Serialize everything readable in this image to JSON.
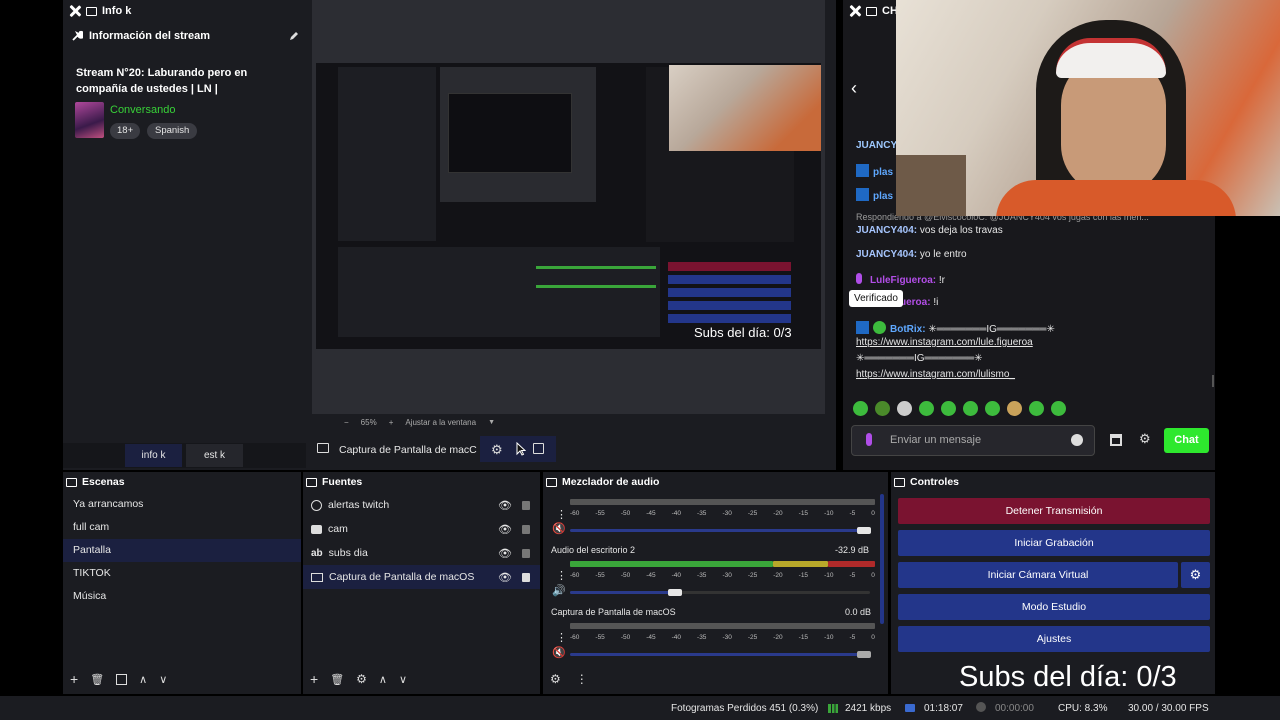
{
  "info_dock": {
    "title": "Info k",
    "header": "Información del stream",
    "stream_title": "Stream N°20: Laburando pero en compañía de ustedes | LN |",
    "category": "Conversando",
    "tags": [
      "18+",
      "Spanish"
    ],
    "tabs": [
      "info k",
      "est k"
    ]
  },
  "preview": {
    "zoom": "65%",
    "fit_label": "Ajustar a la ventana",
    "subs_overlay": "Subs del día: 0/3",
    "source_label": "Captura de Pantalla de macC"
  },
  "chat_dock": {
    "title": "CHA",
    "messages": [
      {
        "user": "JUANCY",
        "text": ""
      },
      {
        "user": "plas",
        "text": ""
      },
      {
        "user": "plas",
        "text": ""
      },
      {
        "reply": "Respondiendo a @ElviscocoloC: @JUANCY404 vos jugas con las men..."
      },
      {
        "user": "JUANCY404:",
        "text": "vos deja los travas"
      },
      {
        "user": "JUANCY404:",
        "text": "yo le entro"
      },
      {
        "user": "LuleFigueroa:",
        "text": "!r"
      },
      {
        "user": "ueroa:",
        "text": "!i"
      },
      {
        "user": "BotRix:",
        "text": "✳═══════IG═══════✳"
      }
    ],
    "links": [
      "https://www.instagram.com/lule.figueroa",
      "✳═══════IG═══════✳",
      "https://www.instagram.com/lulismo_"
    ],
    "tooltip": "Verificado",
    "input_placeholder": "Enviar un mensaje",
    "send_label": "Chat"
  },
  "scenes": {
    "title": "Escenas",
    "items": [
      "Ya arrancamos",
      "full cam",
      "Pantalla",
      "TIKTOK",
      "Música"
    ],
    "active": 2
  },
  "sources": {
    "title": "Fuentes",
    "items": [
      "alertas twitch",
      "cam",
      "subs dia",
      "Captura de Pantalla de macOS"
    ]
  },
  "mixer": {
    "title": "Mezclador de audio",
    "channels": [
      {
        "name": "",
        "db": ""
      },
      {
        "name": "Audio del escritorio 2",
        "db": "-32.9 dB"
      },
      {
        "name": "Captura de Pantalla de macOS",
        "db": "0.0 dB"
      }
    ],
    "ticks": [
      "-60",
      "-55",
      "-50",
      "-45",
      "-40",
      "-35",
      "-30",
      "-25",
      "-20",
      "-15",
      "-10",
      "-5",
      "0"
    ]
  },
  "controls": {
    "title": "Controles",
    "buttons": [
      "Detener Transmisión",
      "Iniciar Grabación",
      "Iniciar Cámara Virtual",
      "Modo Estudio",
      "Ajustes"
    ],
    "subs_overlay": "Subs del día: 0/3"
  },
  "status_bar": {
    "dropped": "Fotogramas Perdidos 451 (0.3%)",
    "bitrate": "2421 kbps",
    "stream_time": "01:18:07",
    "rec_time": "00:00:00",
    "cpu": "CPU: 8.3%",
    "fps": "30.00 / 30.00 FPS"
  },
  "colors": {
    "accent_blue": "#23368a",
    "stop_red": "#7a1330",
    "chat_green": "#2ee82e",
    "category_green": "#38d138"
  }
}
